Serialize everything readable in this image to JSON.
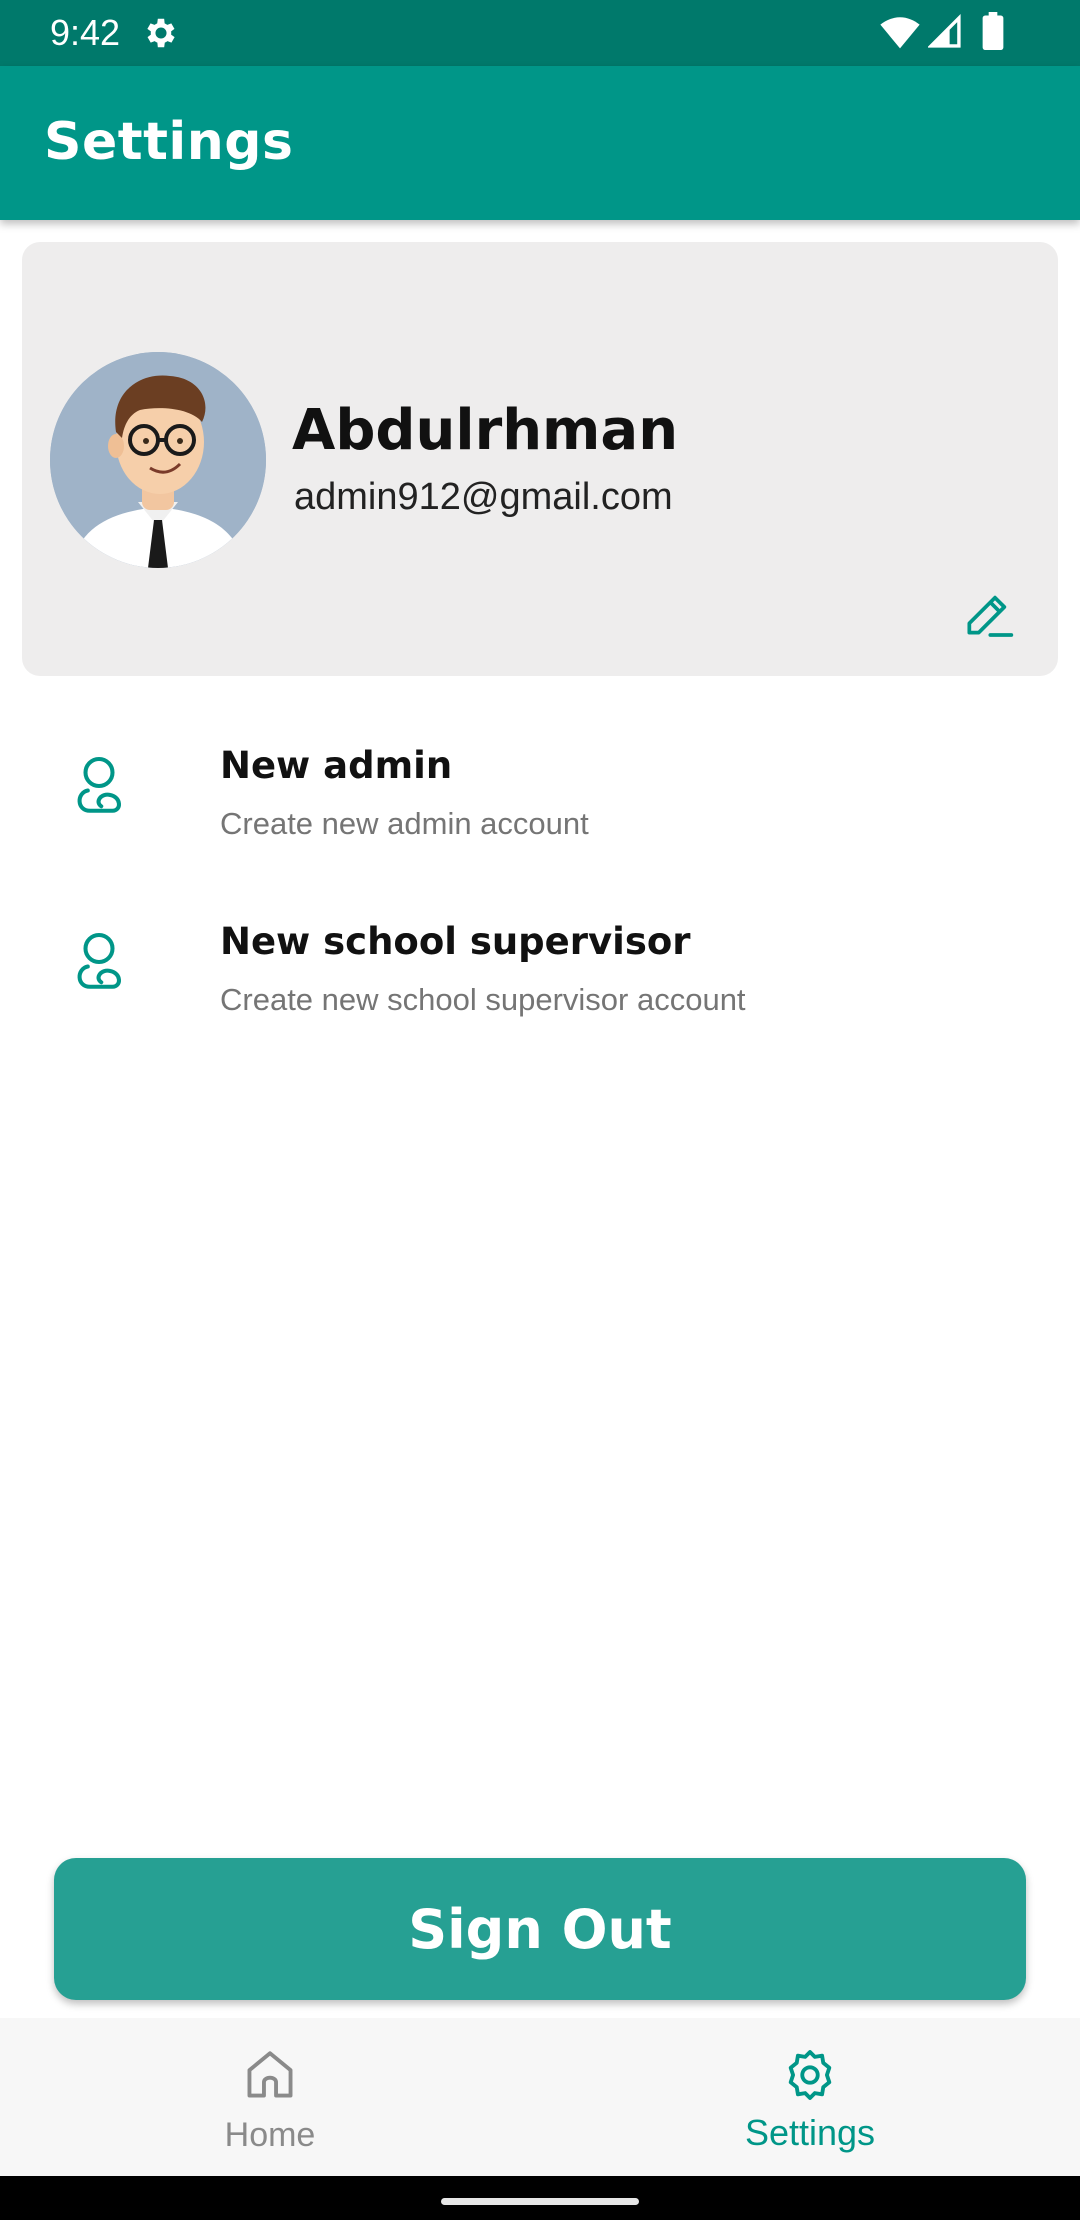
{
  "status_bar": {
    "time": "9:42",
    "icons": [
      "settings-gear-icon",
      "wifi-icon",
      "cellular-signal-icon",
      "battery-icon"
    ]
  },
  "app_bar": {
    "title": "Settings"
  },
  "profile": {
    "name": "Abdulrhman",
    "email": "admin912@gmail.com",
    "avatar_icon": "cartoon-man-avatar",
    "edit_icon": "pencil-edit-icon"
  },
  "settings_items": [
    {
      "title": "New admin",
      "subtitle": "Create new admin account",
      "icon": "person-outline-icon"
    },
    {
      "title": "New school supervisor",
      "subtitle": "Create new school supervisor account",
      "icon": "person-outline-icon"
    }
  ],
  "sign_out": {
    "label": "Sign Out"
  },
  "bottom_nav": {
    "items": [
      {
        "label": "Home",
        "icon": "home-icon",
        "active": false
      },
      {
        "label": "Settings",
        "icon": "settings-icon",
        "active": true
      }
    ]
  },
  "colors": {
    "status_bar": "#00796b",
    "primary": "#009688",
    "button": "#26a093",
    "card_bg": "#eeeded",
    "inactive": "#8a8a8a"
  }
}
